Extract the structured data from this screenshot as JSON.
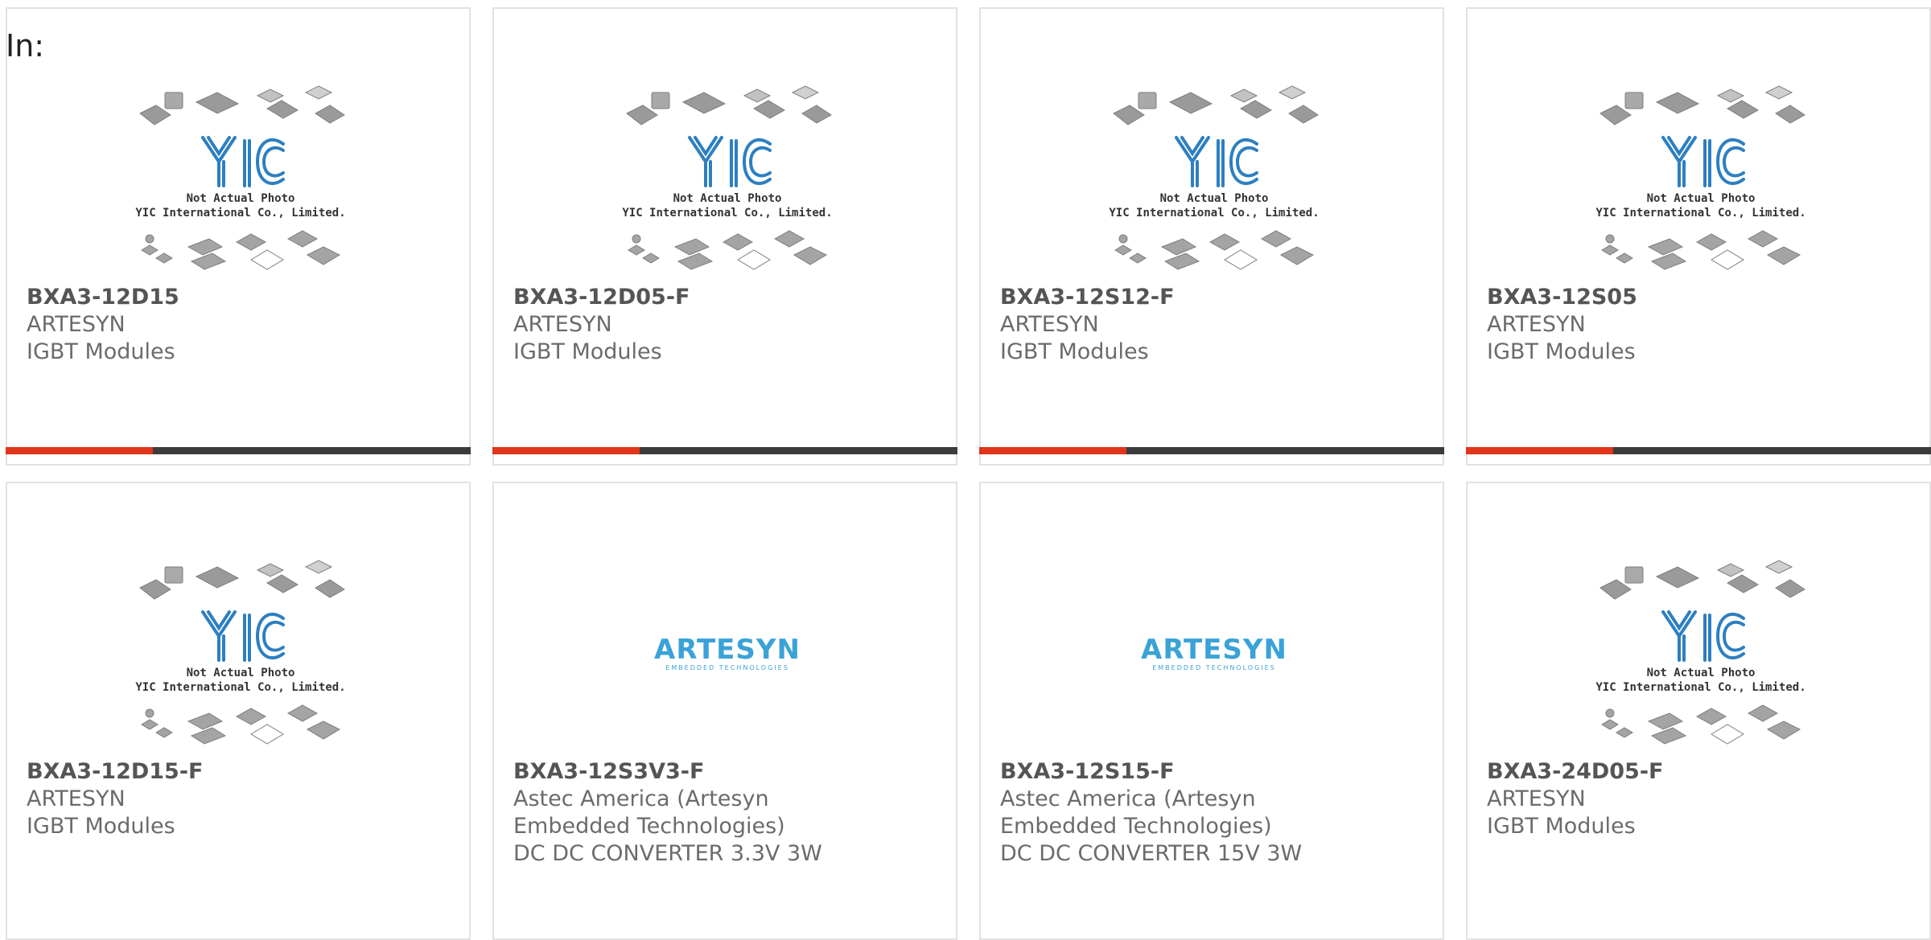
{
  "filter": {
    "label": "In:"
  },
  "colors": {
    "accent": "#e0351a",
    "bar": "#3c3c3c",
    "border": "#e2e2e2",
    "yic_blue": "#2d7fc1",
    "artesyn_blue": "#3ba2d8"
  },
  "placeholder": {
    "line1": "Not Actual Photo",
    "line2": "YIC International Co., Limited.",
    "logo": "YIC"
  },
  "artesyn_logo": {
    "name": "ARTESYN",
    "tagline": "EMBEDDED TECHNOLOGIES"
  },
  "products": [
    {
      "part": "BXA3-12D15",
      "lines": [
        "ARTESYN",
        "IGBT Modules"
      ],
      "image": "yic-placeholder"
    },
    {
      "part": "BXA3-12D05-F",
      "lines": [
        "ARTESYN",
        "IGBT Modules"
      ],
      "image": "yic-placeholder"
    },
    {
      "part": "BXA3-12S12-F",
      "lines": [
        "ARTESYN",
        "IGBT Modules"
      ],
      "image": "yic-placeholder"
    },
    {
      "part": "BXA3-12S05",
      "lines": [
        "ARTESYN",
        "IGBT Modules"
      ],
      "image": "yic-placeholder"
    },
    {
      "part": "BXA3-12D15-F",
      "lines": [
        "ARTESYN",
        "IGBT Modules"
      ],
      "image": "yic-placeholder"
    },
    {
      "part": "BXA3-12S3V3-F",
      "lines": [
        "Astec America (Artesyn",
        "Embedded Technologies)",
        "DC DC CONVERTER 3.3V 3W"
      ],
      "image": "artesyn-logo"
    },
    {
      "part": "BXA3-12S15-F",
      "lines": [
        "Astec America (Artesyn",
        "Embedded Technologies)",
        "DC DC CONVERTER 15V 3W"
      ],
      "image": "artesyn-logo"
    },
    {
      "part": "BXA3-24D05-F",
      "lines": [
        "ARTESYN",
        "IGBT Modules"
      ],
      "image": "yic-placeholder"
    }
  ]
}
